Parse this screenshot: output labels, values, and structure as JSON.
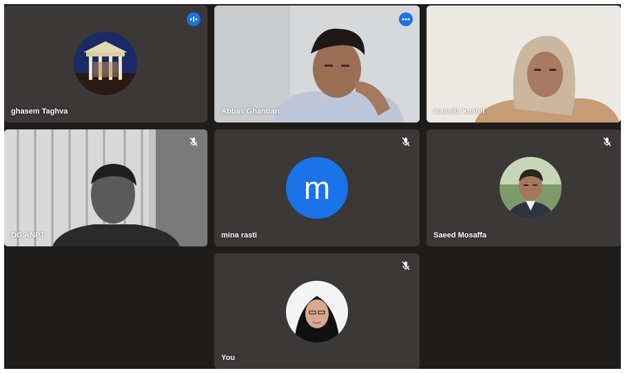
{
  "participants": [
    {
      "name": "ghasem Taghva",
      "state": "speaking"
    },
    {
      "name": "Abbas Ghanbari",
      "state": "more-options"
    },
    {
      "name": "wassila knatef",
      "state": "video"
    },
    {
      "name": "DG ANPT",
      "state": "muted"
    },
    {
      "name": "mina rasti",
      "state": "muted",
      "avatar_letter": "m"
    },
    {
      "name": "Saeed Mosaffa",
      "state": "muted"
    },
    {
      "name": "You",
      "state": "muted"
    }
  ],
  "colors": {
    "background": "#1f1c1c",
    "tile": "#3b3837",
    "accent": "#1a73e8"
  }
}
